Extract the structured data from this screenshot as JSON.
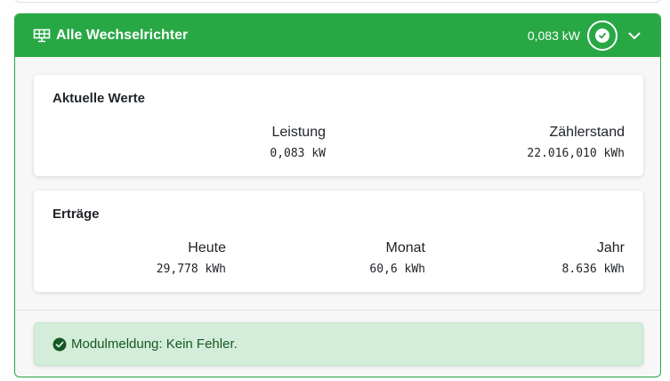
{
  "panel": {
    "title": "Alle Wechselrichter",
    "power": "0,083 kW",
    "icons": {
      "solar": "solar-panel-icon",
      "status": "check-circle-icon",
      "toggle": "chevron-down-icon"
    },
    "accent_color": "#28a745"
  },
  "current_values": {
    "title": "Aktuelle Werte",
    "items": [
      {
        "label": "Leistung",
        "value": "0,083 kW"
      },
      {
        "label": "Zählerstand",
        "value": "22.016,010 kWh"
      }
    ]
  },
  "yields": {
    "title": "Erträge",
    "items": [
      {
        "label": "Heute",
        "value": "29,778 kWh"
      },
      {
        "label": "Monat",
        "value": "60,6 kWh"
      },
      {
        "label": "Jahr",
        "value": "8.636 kWh"
      }
    ]
  },
  "status": {
    "message": "Modulmeldung: Kein Fehler.",
    "icon": "check-circle-icon",
    "color": "#155724"
  }
}
